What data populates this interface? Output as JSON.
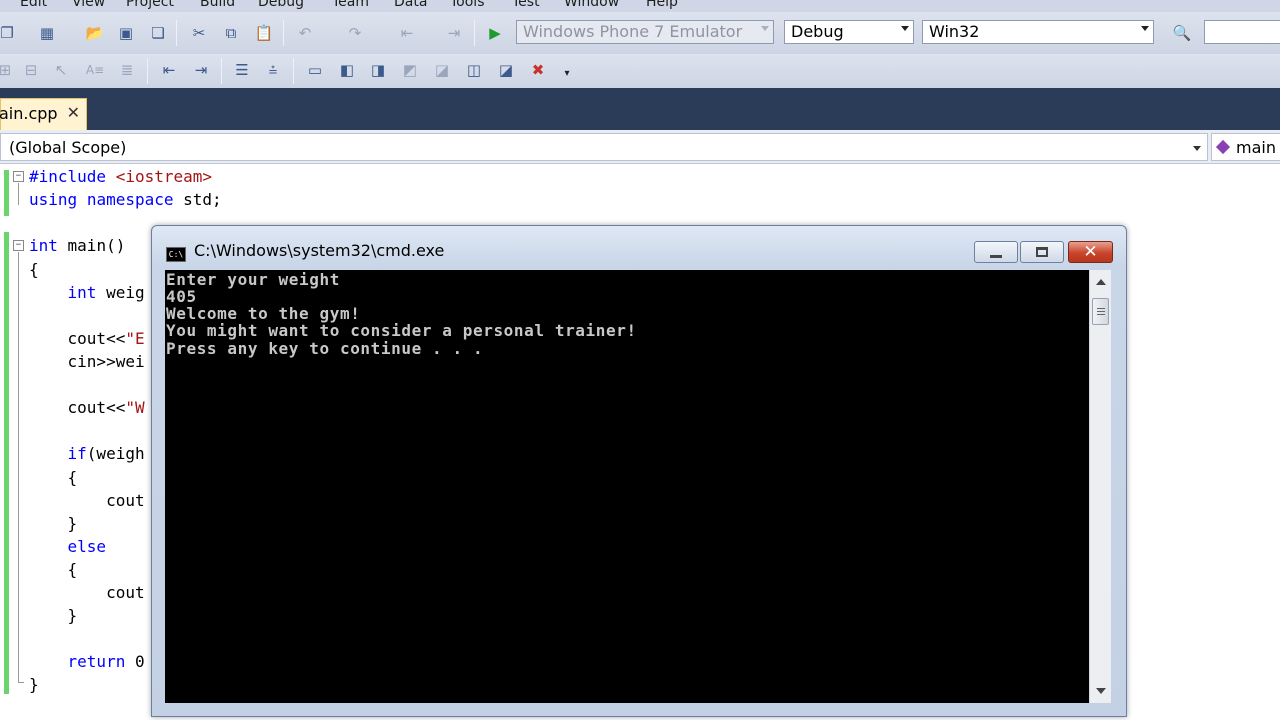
{
  "menu": {
    "items": [
      "Edit",
      "View",
      "Project",
      "Build",
      "Debug",
      "Team",
      "Data",
      "Tools",
      "Test",
      "Window",
      "Help"
    ]
  },
  "toolbar": {
    "platform_target": "Windows Phone 7 Emulator",
    "configuration": "Debug",
    "platform": "Win32"
  },
  "editor_tab": {
    "filename": "ain.cpp",
    "close_glyph": "✕"
  },
  "navbar": {
    "scope": "(Global Scope)",
    "member": "main"
  },
  "code": {
    "lines": [
      "#include <iostream>",
      "using namespace std;",
      "int main()",
      "{",
      "    int weig",
      "    cout<<\"E",
      "    cin>>wei",
      "    cout<<\"W",
      "    if(weigh",
      "    {",
      "        cout",
      "    }",
      "    else",
      "    {",
      "        cout",
      "    }",
      "    return 0",
      "}"
    ]
  },
  "console": {
    "title": "C:\\Windows\\system32\\cmd.exe",
    "icon_label": "C:\\",
    "lines": [
      "Enter your weight",
      "405",
      "Welcome to the gym!",
      "You might want to consider a personal trainer!",
      "Press any key to continue . . ."
    ]
  },
  "colors": {
    "tab_strip": "#2b3c59",
    "active_tab": "#fff3d1",
    "keyword": "#0000ff",
    "string": "#a31515",
    "change_margin": "#6cd46c",
    "close_button": "#c9452c"
  }
}
